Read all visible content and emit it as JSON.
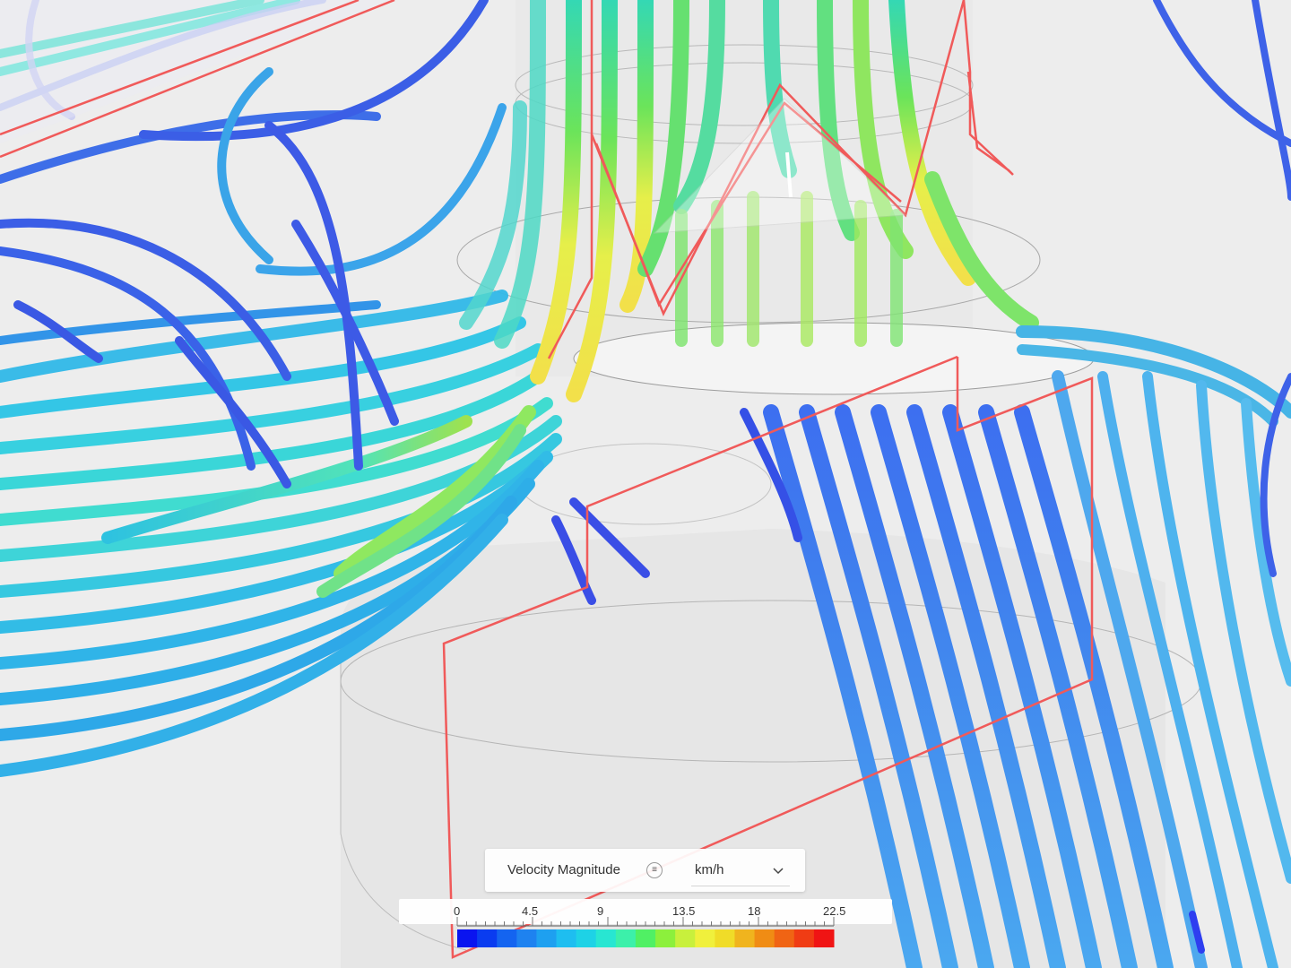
{
  "viewer": {
    "field_label": "Velocity Magnitude",
    "field_menu_icon": "menu-lines-icon",
    "unit": "km/h",
    "unit_chevron_icon": "chevron-down-icon"
  },
  "legend": {
    "tick_labels": [
      "0",
      "4.5",
      "9",
      "13.5",
      "18",
      "22.5"
    ],
    "min": 0,
    "max": 22.5,
    "colors": [
      "#0a14f0",
      "#0a3cf0",
      "#1464f0",
      "#1e82f0",
      "#1ea0f0",
      "#1ebef0",
      "#1ed2e6",
      "#28e6d2",
      "#3cf0aa",
      "#50f064",
      "#8cf03c",
      "#c8f03c",
      "#f0f03c",
      "#f0dc28",
      "#f0b41e",
      "#f08c14",
      "#f06414",
      "#f03c14",
      "#f01414"
    ]
  }
}
